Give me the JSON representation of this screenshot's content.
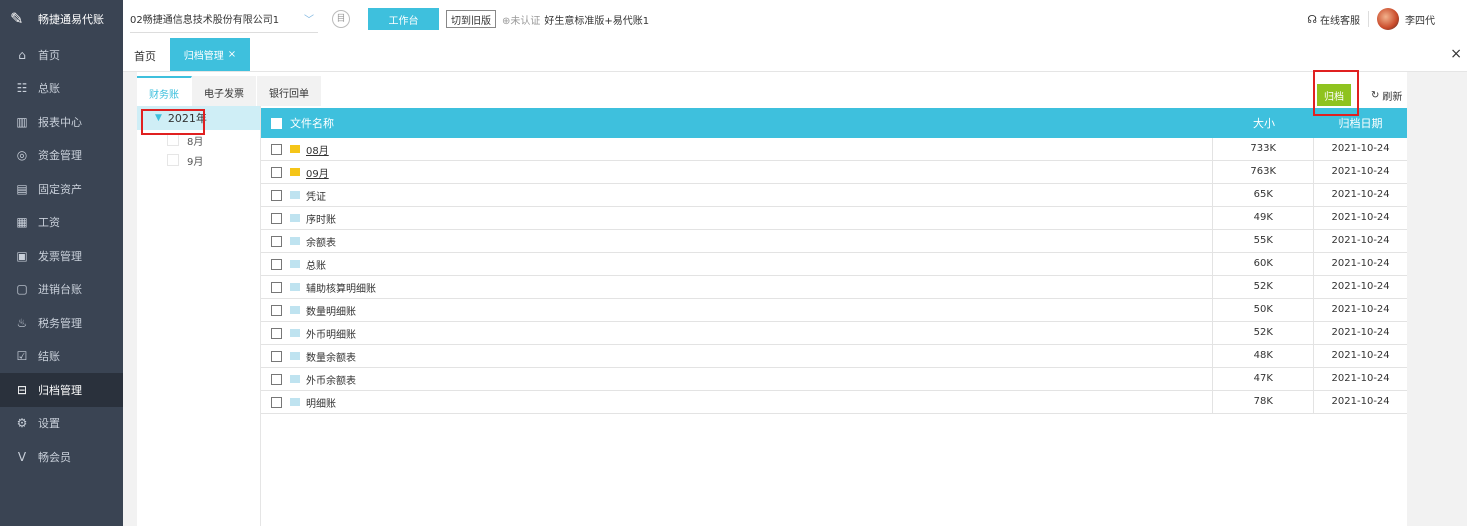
{
  "app": {
    "logo_text": "畅捷通易代账"
  },
  "sidebar": {
    "items": [
      {
        "label": "首页",
        "icon": "home-icon",
        "glyph": "⌂"
      },
      {
        "label": "总账",
        "icon": "ledger-icon",
        "glyph": "☷"
      },
      {
        "label": "报表中心",
        "icon": "chart-icon",
        "glyph": "▥"
      },
      {
        "label": "资金管理",
        "icon": "money-icon",
        "glyph": "◎"
      },
      {
        "label": "固定资产",
        "icon": "asset-icon",
        "glyph": "▤"
      },
      {
        "label": "工资",
        "icon": "salary-icon",
        "glyph": "▦"
      },
      {
        "label": "发票管理",
        "icon": "invoice-icon",
        "glyph": "▣"
      },
      {
        "label": "进销台账",
        "icon": "inventory-icon",
        "glyph": "▢"
      },
      {
        "label": "税务管理",
        "icon": "tax-icon",
        "glyph": "♨"
      },
      {
        "label": "结账",
        "icon": "close-books-icon",
        "glyph": "☑"
      },
      {
        "label": "归档管理",
        "icon": "archive-icon",
        "glyph": "⊟"
      },
      {
        "label": "设置",
        "icon": "settings-icon",
        "glyph": "⚙"
      },
      {
        "label": "畅会员",
        "icon": "vip-icon",
        "glyph": "V"
      }
    ],
    "active_index": 10
  },
  "topbar": {
    "company": "02畅捷通信息技术股份有限公司1",
    "workbench": "工作台",
    "switch_old": "切到旧版",
    "unverified": "未认证",
    "edition": "好生意标准版+易代账1",
    "support": "在线客服",
    "user": "李四代"
  },
  "tabs": {
    "home": "首页",
    "archive": "归档管理",
    "close": "×",
    "close_all": "×"
  },
  "subtabs": [
    "财务账",
    "电子发票",
    "银行回单"
  ],
  "tree": {
    "year": "2021年",
    "months": [
      "8月",
      "9月"
    ]
  },
  "actions": {
    "archive": "归档",
    "refresh": "刷新"
  },
  "table": {
    "headers": {
      "name": "文件名称",
      "size": "大小",
      "date": "归档日期"
    },
    "rows": [
      {
        "name": "08月",
        "size": "733K",
        "date": "2021-10-24",
        "type": "folder"
      },
      {
        "name": "09月",
        "size": "763K",
        "date": "2021-10-24",
        "type": "folder"
      },
      {
        "name": "凭证",
        "size": "65K",
        "date": "2021-10-24",
        "type": "file"
      },
      {
        "name": "序时账",
        "size": "49K",
        "date": "2021-10-24",
        "type": "file"
      },
      {
        "name": "余额表",
        "size": "55K",
        "date": "2021-10-24",
        "type": "file"
      },
      {
        "name": "总账",
        "size": "60K",
        "date": "2021-10-24",
        "type": "file"
      },
      {
        "name": "辅助核算明细账",
        "size": "52K",
        "date": "2021-10-24",
        "type": "file"
      },
      {
        "name": "数量明细账",
        "size": "50K",
        "date": "2021-10-24",
        "type": "file"
      },
      {
        "name": "外币明细账",
        "size": "52K",
        "date": "2021-10-24",
        "type": "file"
      },
      {
        "name": "数量余额表",
        "size": "48K",
        "date": "2021-10-24",
        "type": "file"
      },
      {
        "name": "外币余额表",
        "size": "47K",
        "date": "2021-10-24",
        "type": "file"
      },
      {
        "name": "明细账",
        "size": "78K",
        "date": "2021-10-24",
        "type": "file"
      }
    ]
  },
  "colors": {
    "accent": "#3ec0dd",
    "archive_btn": "#8fc31f",
    "sidebar_bg": "#3a4453",
    "highlight": "#e02020"
  }
}
